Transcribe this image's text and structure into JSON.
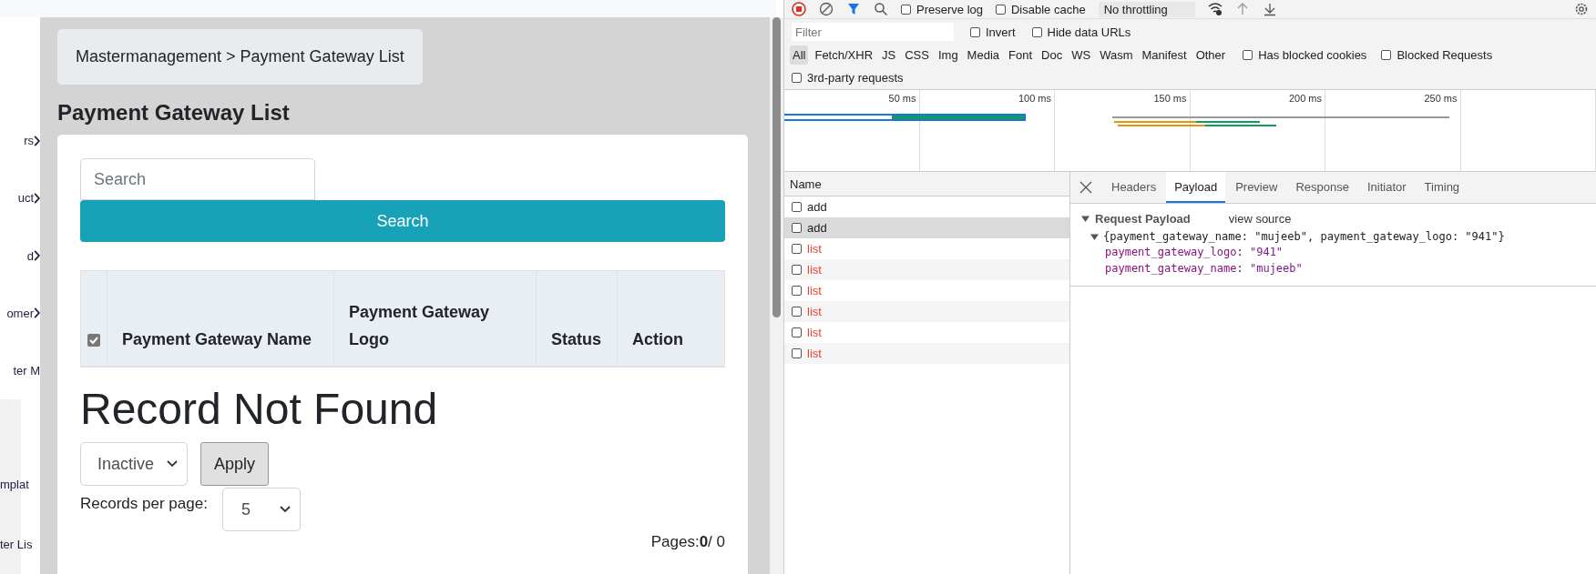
{
  "sidebar": {
    "items": [
      {
        "label": "rs",
        "has_chevron": true
      },
      {
        "label": "uct",
        "has_chevron": true
      },
      {
        "label": "d",
        "has_chevron": true
      },
      {
        "label": "omer",
        "has_chevron": true
      },
      {
        "label": "ter M",
        "has_chevron": false
      }
    ],
    "sub_items": [
      {
        "label": "mplat"
      },
      {
        "label": "ter Lis"
      }
    ]
  },
  "breadcrumb": "Mastermanagement > Payment Gateway List",
  "page_title": "Payment Gateway List",
  "search": {
    "placeholder": "Search",
    "button": "Search"
  },
  "table": {
    "header_checkbox": {
      "checked": true
    },
    "columns": [
      "Payment Gateway Name",
      "Payment Gateway Logo",
      "Status",
      "Action"
    ]
  },
  "empty_message": "Record Not Found",
  "status_select": {
    "value": "Inactive"
  },
  "apply_button": "Apply",
  "records_per_page": {
    "label": "Records per page:",
    "value": "5"
  },
  "pages": {
    "label": "Pages:",
    "current": "0",
    "total": "/ 0"
  },
  "devtools": {
    "toolbar": {
      "checkboxes": [
        {
          "label": "Preserve log",
          "checked": false
        },
        {
          "label": "Disable cache",
          "checked": false
        }
      ],
      "throttling": "No throttling"
    },
    "filter": {
      "placeholder": "Filter",
      "checkboxes": [
        {
          "label": "Invert",
          "checked": false
        },
        {
          "label": "Hide data URLs",
          "checked": false
        }
      ]
    },
    "types": [
      {
        "label": "All",
        "selected": true
      },
      {
        "label": "Fetch/XHR",
        "selected": false
      },
      {
        "label": "JS",
        "selected": false
      },
      {
        "label": "CSS",
        "selected": false
      },
      {
        "label": "Img",
        "selected": false
      },
      {
        "label": "Media",
        "selected": false
      },
      {
        "label": "Font",
        "selected": false
      },
      {
        "label": "Doc",
        "selected": false
      },
      {
        "label": "WS",
        "selected": false
      },
      {
        "label": "Wasm",
        "selected": false
      },
      {
        "label": "Manifest",
        "selected": false
      },
      {
        "label": "Other",
        "selected": false
      }
    ],
    "type_checkboxes": [
      {
        "label": "Has blocked cookies",
        "checked": false
      },
      {
        "label": "Blocked Requests",
        "checked": false
      },
      {
        "label": "3rd-party requests",
        "checked": false
      }
    ],
    "timeline_ticks": [
      "50 ms",
      "100 ms",
      "150 ms",
      "200 ms",
      "250 ms"
    ],
    "requests": {
      "column": "Name",
      "rows": [
        {
          "name": "add",
          "failed": false,
          "selected": false
        },
        {
          "name": "add",
          "failed": false,
          "selected": true
        },
        {
          "name": "list",
          "failed": true,
          "selected": false
        },
        {
          "name": "list",
          "failed": true,
          "selected": false
        },
        {
          "name": "list",
          "failed": true,
          "selected": false
        },
        {
          "name": "list",
          "failed": true,
          "selected": false
        },
        {
          "name": "list",
          "failed": true,
          "selected": false
        },
        {
          "name": "list",
          "failed": true,
          "selected": false
        }
      ]
    },
    "detail_tabs": [
      {
        "label": "Headers",
        "selected": false
      },
      {
        "label": "Payload",
        "selected": true
      },
      {
        "label": "Preview",
        "selected": false
      },
      {
        "label": "Response",
        "selected": false
      },
      {
        "label": "Initiator",
        "selected": false
      },
      {
        "label": "Timing",
        "selected": false
      }
    ],
    "payload": {
      "title": "Request Payload",
      "expanded": true,
      "view_source": "view source",
      "summary": "{payment_gateway_name: \"mujeeb\", payment_gateway_logo: \"941\"}",
      "object_expanded": true,
      "properties": [
        {
          "key": "payment_gateway_logo",
          "separator": ":",
          "value": "\"941\""
        },
        {
          "key": "payment_gateway_name",
          "separator": ":",
          "value": "\"mujeeb\""
        }
      ]
    }
  }
}
